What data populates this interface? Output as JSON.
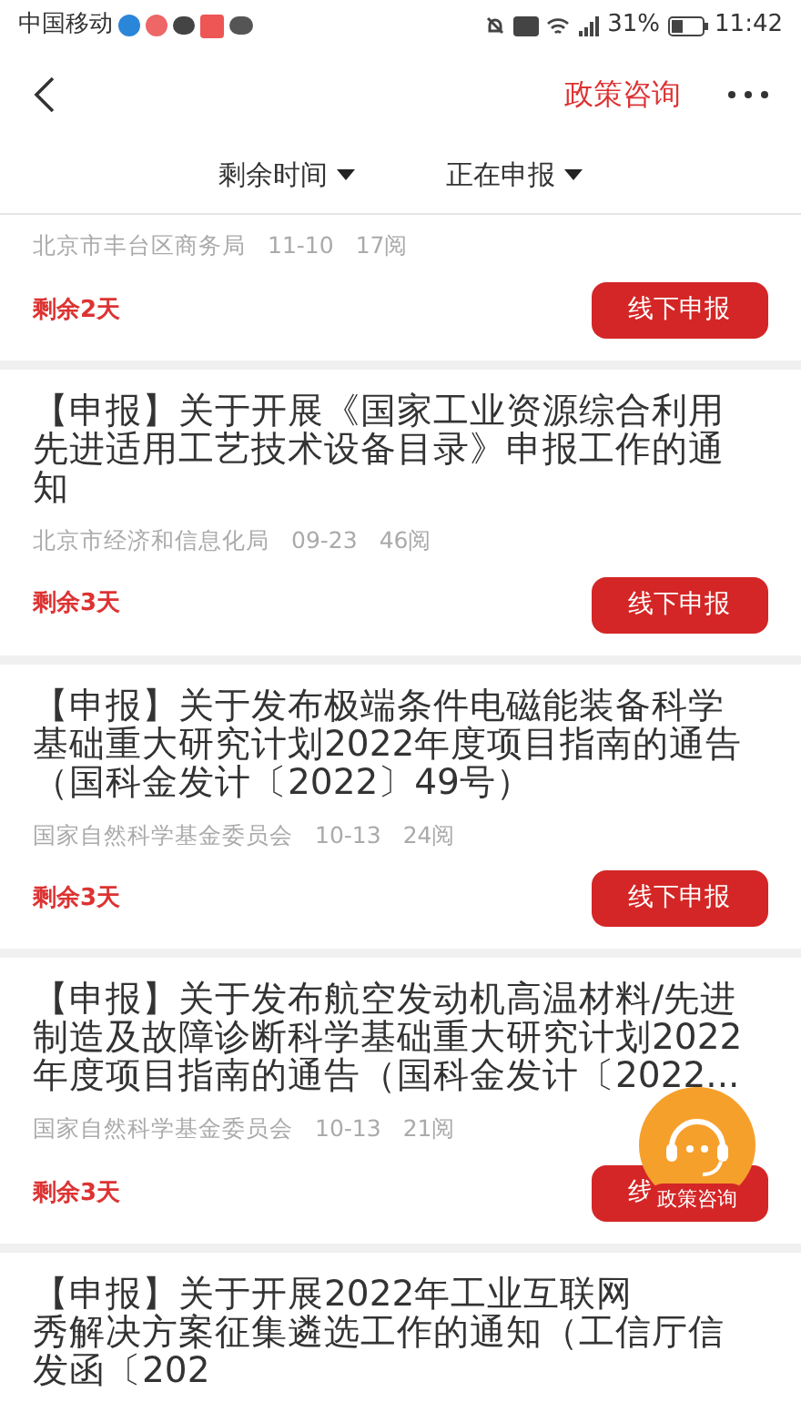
{
  "status_bar": {
    "carrier": "中国移动",
    "battery": "31%",
    "time": "11:42"
  },
  "header": {
    "action": "政策咨询"
  },
  "filters": [
    {
      "label": "剩余时间"
    },
    {
      "label": "正在申报"
    }
  ],
  "items": [
    {
      "source": "北京市丰台区商务局",
      "date": "11-10",
      "reads": "17阅",
      "remaining": "剩余2天",
      "button": "线下申报"
    },
    {
      "title_lines": [
        "【申报】关于开展《国家工业资源综合利用",
        "先进适用工艺技术设备目录》申报工作的通",
        "知"
      ],
      "source": "北京市经济和信息化局",
      "date": "09-23",
      "reads": "46阅",
      "remaining": "剩余3天",
      "button": "线下申报"
    },
    {
      "title_lines": [
        "【申报】关于发布极端条件电磁能装备科学",
        "基础重大研究计划2022年度项目指南的通告",
        "（国科金发计〔2022〕49号）"
      ],
      "source": "国家自然科学基金委员会",
      "date": "10-13",
      "reads": "24阅",
      "remaining": "剩余3天",
      "button": "线下申报"
    },
    {
      "title_lines": [
        "【申报】关于发布航空发动机高温材料/先进",
        "制造及故障诊断科学基础重大研究计划2022",
        "年度项目指南的通告（国科金发计〔2022..."
      ],
      "source": "国家自然科学基金委员会",
      "date": "10-13",
      "reads": "21阅",
      "remaining": "剩余3天",
      "button": "线"
    },
    {
      "title_lines": [
        "【申报】关于开展2022年工业互联网",
        "秀解决方案征集遴选工作的通知（工信厅信",
        "发函〔202"
      ]
    }
  ],
  "float_button": {
    "label": "政策咨询"
  }
}
